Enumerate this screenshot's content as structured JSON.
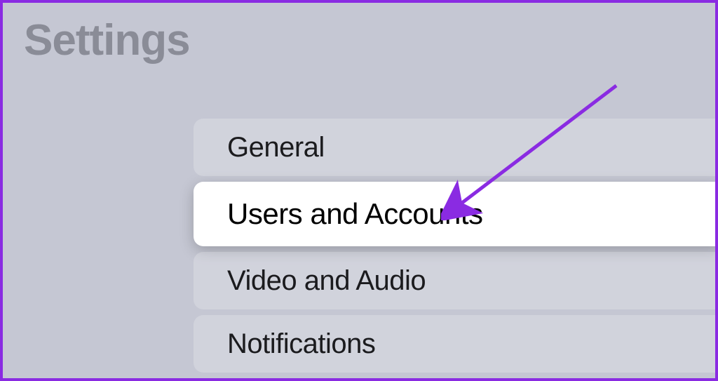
{
  "title": "Settings",
  "menu": {
    "items": [
      {
        "label": "General",
        "selected": false
      },
      {
        "label": "Users and Accounts",
        "selected": true
      },
      {
        "label": "Video and Audio",
        "selected": false
      },
      {
        "label": "Notifications",
        "selected": false
      }
    ]
  },
  "accent_color": "#8a2be2"
}
